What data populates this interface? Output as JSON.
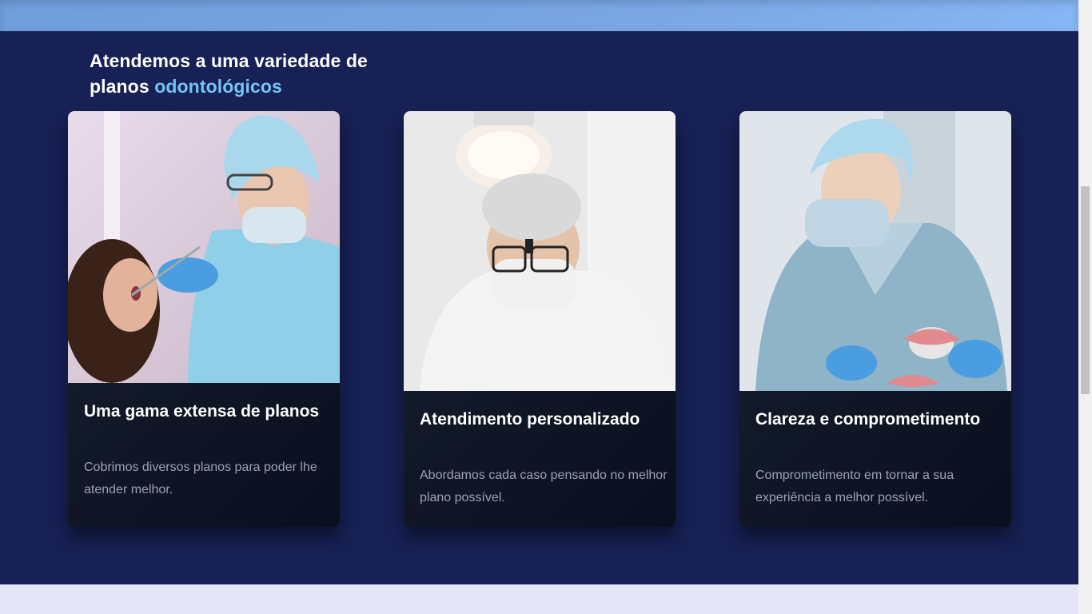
{
  "section": {
    "heading_main": "Atendemos a uma variedade de planos",
    "heading_accent": "odontológicos"
  },
  "cards": [
    {
      "image_alt": "dentista examinando paciente",
      "title": "Uma gama extensa de planos",
      "text": "Cobrimos diversos planos para poder lhe atender melhor."
    },
    {
      "image_alt": "dentista com lupa e touca",
      "title": "Atendimento personalizado",
      "text": "Abordamos cada caso pensando no melhor plano possível."
    },
    {
      "image_alt": "dentista segurando modelo de arcada dentária",
      "title": "Clareza e comprometimento",
      "text": "Comprometimento em tornar a sua experiência a melhor possível."
    }
  ],
  "colors": {
    "section_bg": "#172155",
    "accent": "#75c4f7",
    "lower_bg": "#e6e4f7"
  }
}
